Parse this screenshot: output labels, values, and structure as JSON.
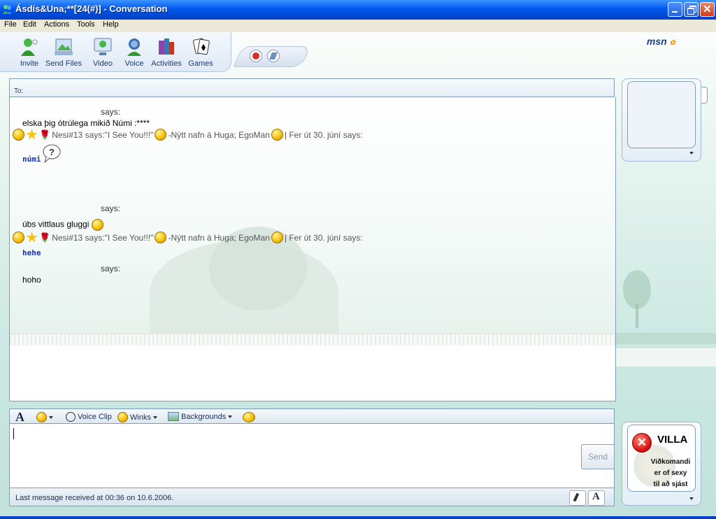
{
  "window": {
    "title": "Ásdís&Una;**[24(#)] - Conversation"
  },
  "menu": [
    "File",
    "Edit",
    "Actions",
    "Tools",
    "Help"
  ],
  "toolbar": {
    "buttons": [
      "Invite",
      "Send Files",
      "Video",
      "Voice",
      "Activities",
      "Games"
    ],
    "logo": "msn"
  },
  "to_label": "To:",
  "conversation": {
    "says": "says:",
    "msg1": "elska þig ótrúlega mikið Númi :****",
    "sig1_a": "Nesi#13 says:\"I See You!!!\"",
    "sig1_b": "-Nýtt nafn á Huga; EgoMan",
    "sig1_c": "| Fer út 30. júní says:",
    "ink1": "númi",
    "msg2": "úbs vittlaus gluggi",
    "ink2": "hehe",
    "msg3": "hoho"
  },
  "format_bar": {
    "font_icon": "A",
    "voice_clip": "Voice Clip",
    "winks": "Winks",
    "backgrounds": "Backgrounds"
  },
  "input": {
    "send_label": "Send",
    "value": ""
  },
  "status": {
    "text": "Last message received at 00:36 on 10.6.2006."
  },
  "villa_image": {
    "title": "VILLA",
    "line1": "Viðkomandi",
    "line2": "er of sexy",
    "line3": "til að sjást"
  },
  "colors": {
    "accent": "#0058ee",
    "ink": "#1a2fb5"
  }
}
